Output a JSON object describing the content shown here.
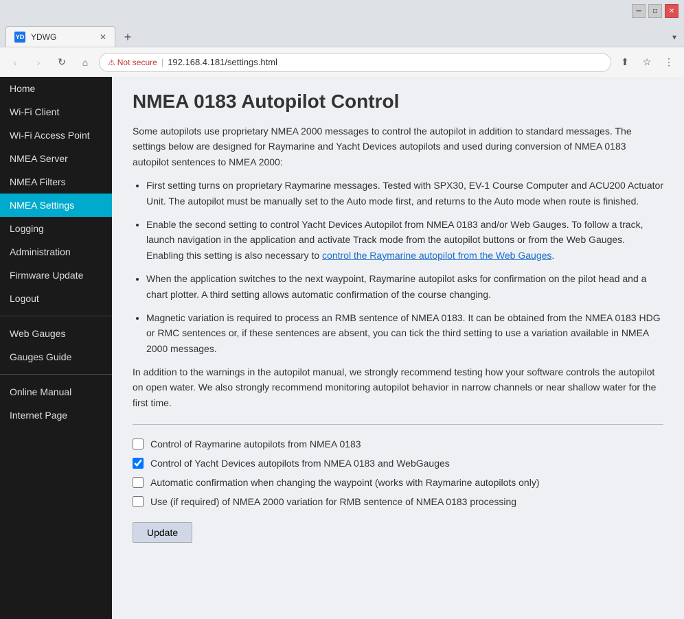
{
  "browser": {
    "tab_favicon": "YD",
    "tab_title": "YDWG",
    "new_tab_icon": "+",
    "nav_back": "‹",
    "nav_forward": "›",
    "nav_refresh": "↻",
    "nav_home": "⌂",
    "not_secure_label": "Not secure",
    "url": "192.168.4.181/settings.html",
    "share_icon": "⬆",
    "star_icon": "☆",
    "menu_icon": "⋮",
    "minimize_icon": "─",
    "restore_icon": "□",
    "close_icon": "✕"
  },
  "sidebar": {
    "items": [
      {
        "label": "Home",
        "active": false
      },
      {
        "label": "Wi-Fi Client",
        "active": false
      },
      {
        "label": "Wi-Fi Access Point",
        "active": false
      },
      {
        "label": "NMEA Server",
        "active": false
      },
      {
        "label": "NMEA Filters",
        "active": false
      },
      {
        "label": "NMEA Settings",
        "active": true
      },
      {
        "label": "Logging",
        "active": false
      },
      {
        "label": "Administration",
        "active": false
      },
      {
        "label": "Firmware Update",
        "active": false
      },
      {
        "label": "Logout",
        "active": false
      },
      {
        "label": "Web Gauges",
        "active": false
      },
      {
        "label": "Gauges Guide",
        "active": false
      },
      {
        "label": "Online Manual",
        "active": false
      },
      {
        "label": "Internet Page",
        "active": false
      }
    ]
  },
  "page": {
    "title": "NMEA 0183 Autopilot Control",
    "intro": "Some autopilots use proprietary NMEA 2000 messages to control the autopilot in addition to standard messages. The settings below are designed for Raymarine and Yacht Devices autopilots and used during conversion of NMEA 0183 autopilot sentences to NMEA 2000:",
    "bullets": [
      "First setting turns on proprietary Raymarine messages. Tested with SPX30, EV-1 Course Computer and ACU200 Actuator Unit. The autopilot must be manually set to the Auto mode first, and returns to the Auto mode when route is finished.",
      "Enable the second setting to control Yacht Devices Autopilot from NMEA 0183 and/or Web Gauges. To follow a track, launch navigation in the application and activate Track mode from the autopilot buttons or from the Web Gauges. Enabling this setting is also necessary to",
      "When the application switches to the next waypoint, Raymarine autopilot asks for confirmation on the pilot head and a chart plotter. A third setting allows automatic confirmation of the course changing.",
      "Magnetic variation is required to process an RMB sentence of NMEA 0183. It can be obtained from the NMEA 0183 HDG or RMC sentences or, if these sentences are absent, you can tick the third setting to use a variation available in NMEA 2000 messages."
    ],
    "bullet2_link": "control the Raymarine autopilot from the Web Gauges",
    "warning": "In addition to the warnings in the autopilot manual, we strongly recommend testing how your software controls the autopilot on open water. We also strongly recommend monitoring autopilot behavior in narrow channels or near shallow water for the first time.",
    "checkboxes": [
      {
        "label": "Control of Raymarine autopilots from NMEA 0183",
        "checked": false
      },
      {
        "label": "Control of Yacht Devices autopilots from NMEA 0183 and WebGauges",
        "checked": true
      },
      {
        "label": "Automatic confirmation when changing the waypoint (works with Raymarine autopilots only)",
        "checked": false
      },
      {
        "label": "Use (if required) of NMEA 2000 variation for RMB sentence of NMEA 0183 processing",
        "checked": false
      }
    ],
    "update_button": "Update"
  }
}
